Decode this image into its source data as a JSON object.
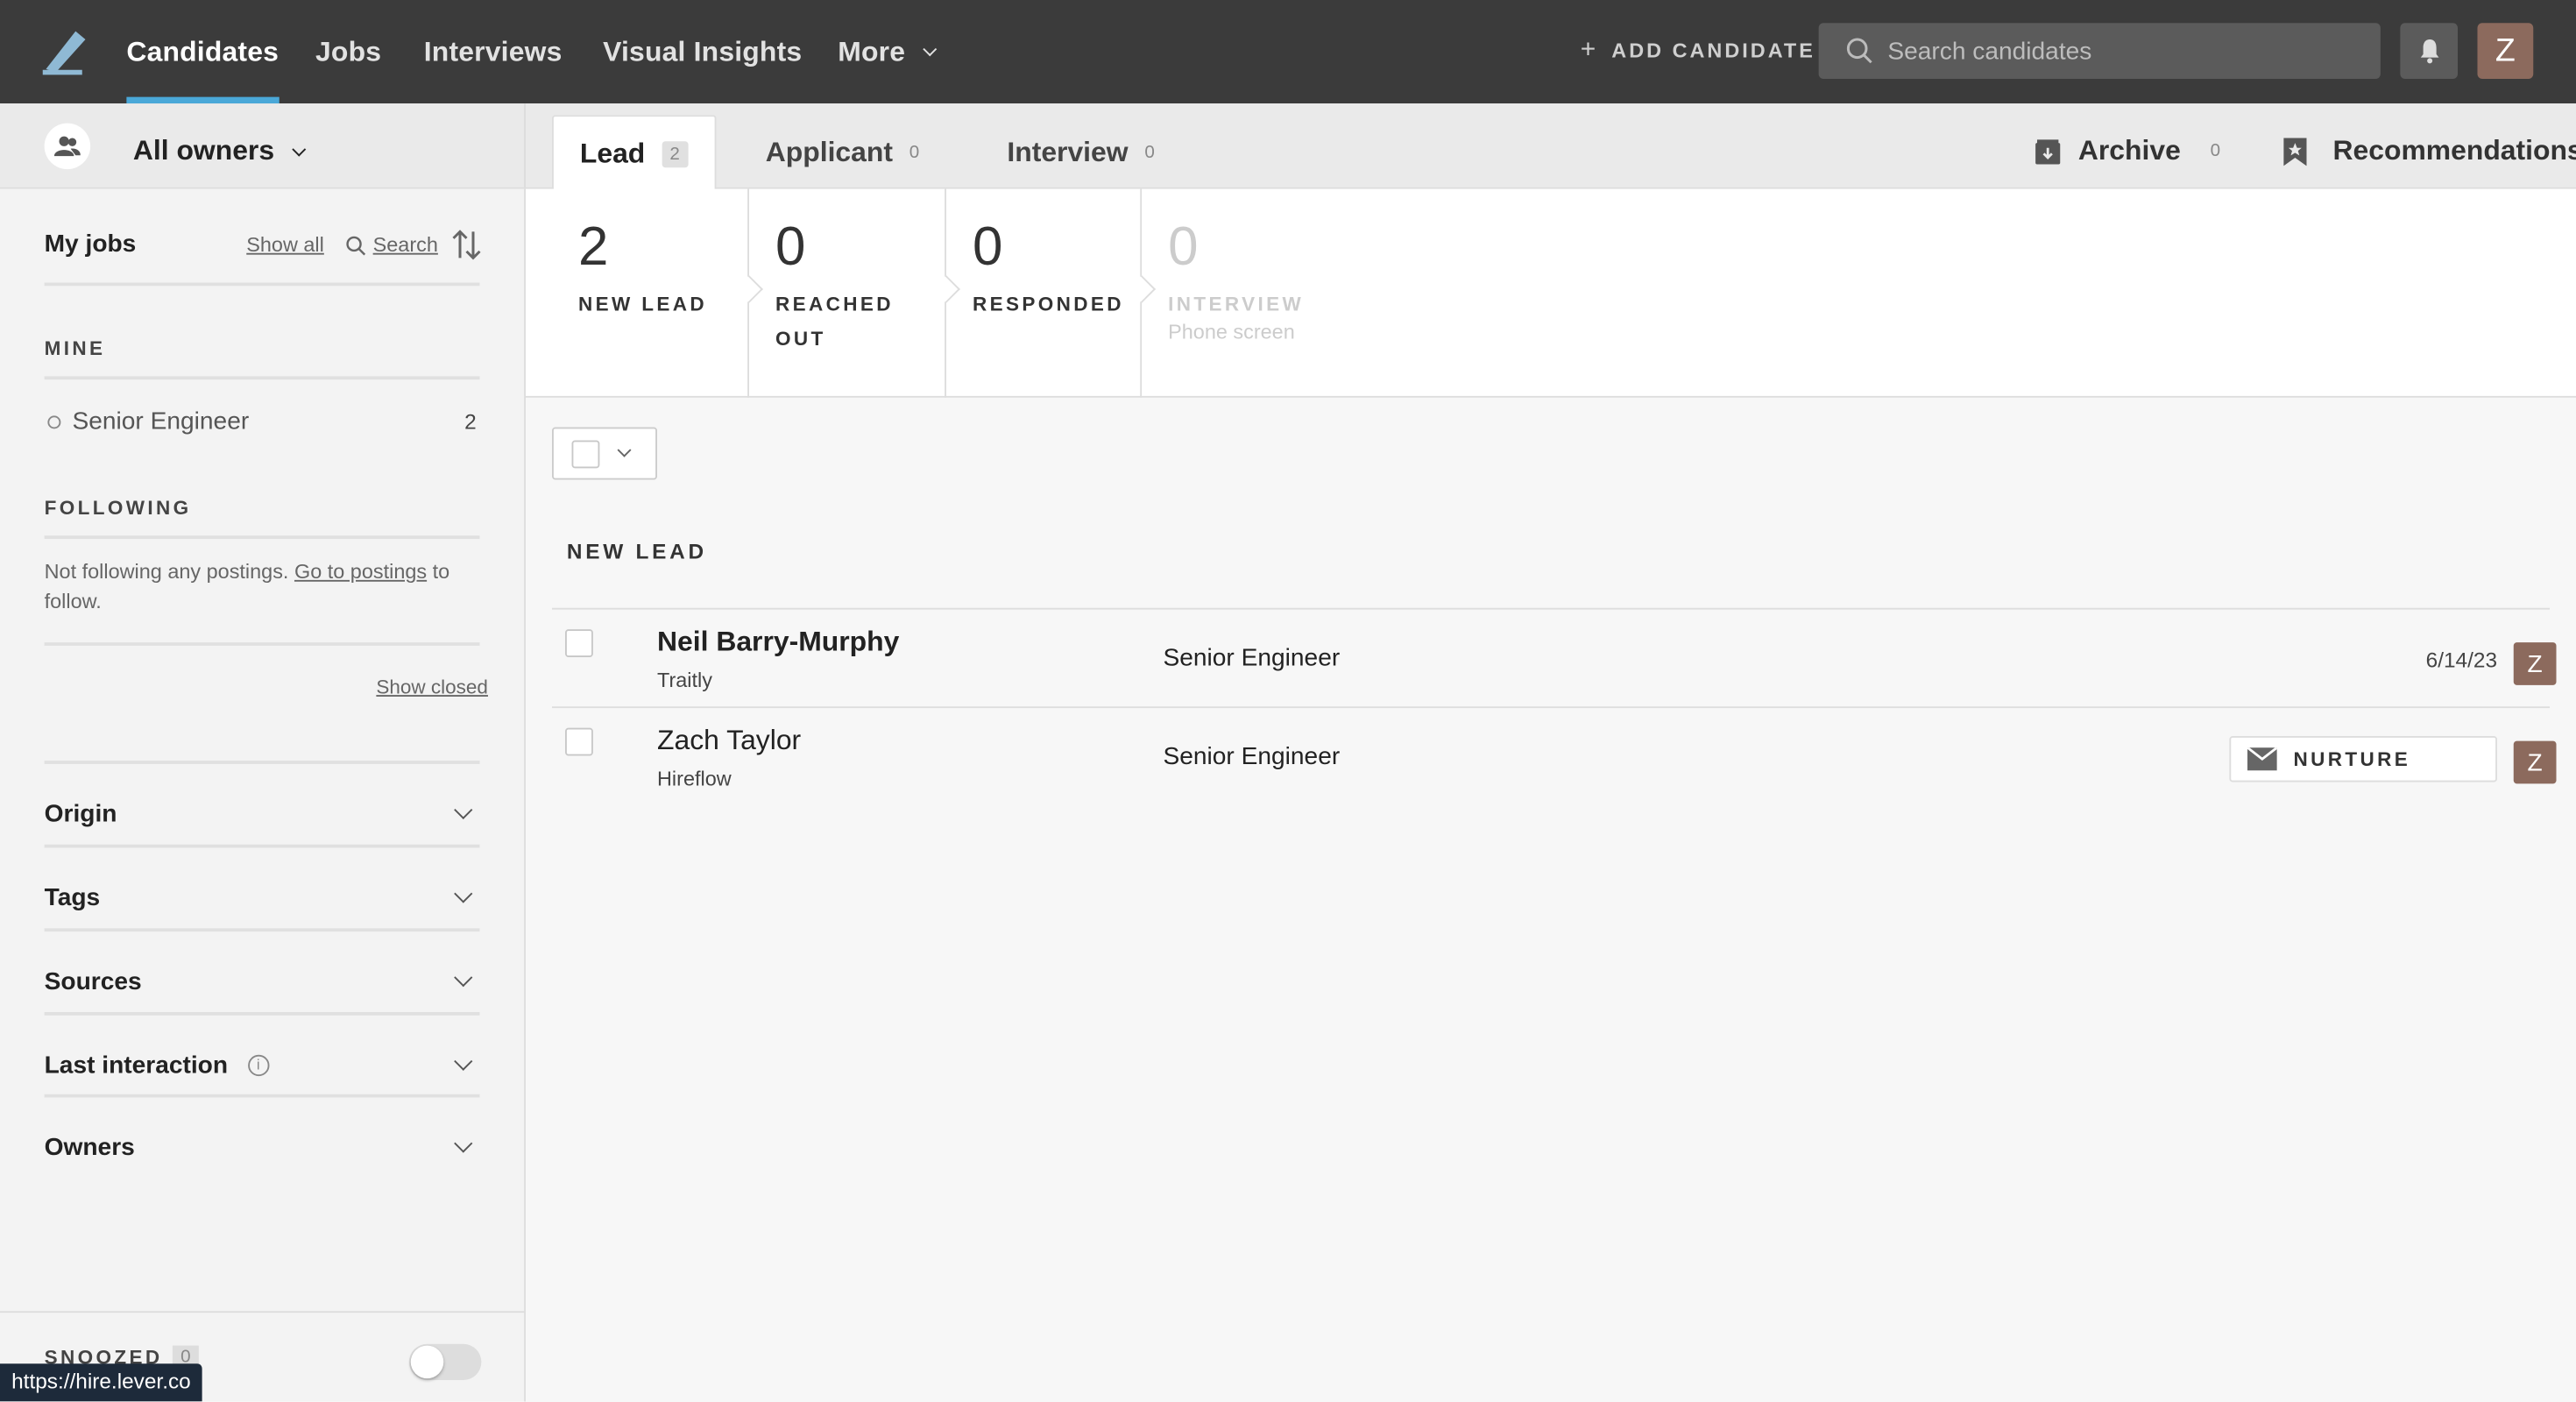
{
  "nav": {
    "items": [
      "Candidates",
      "Jobs",
      "Interviews",
      "Visual Insights",
      "More"
    ],
    "active": "Candidates",
    "add_candidate": "ADD CANDIDATE",
    "search_placeholder": "Search candidates",
    "user_initial": "Z"
  },
  "sidebar": {
    "owner_filter": "All owners",
    "my_jobs": "My jobs",
    "show_all": "Show all",
    "search": "Search",
    "mine_label": "MINE",
    "mine_items": [
      {
        "label": "Senior Engineer",
        "count": "2"
      }
    ],
    "following_label": "FOLLOWING",
    "following_text": "Not following any postings.",
    "go_to_postings": "Go to postings",
    "following_suffix": "to",
    "following_suffix2": "follow.",
    "show_closed": "Show closed",
    "filters": [
      "Origin",
      "Tags",
      "Sources",
      "Last interaction",
      "Owners"
    ],
    "snoozed_label": "SNOOZED",
    "snoozed_count": "0"
  },
  "tabs": {
    "items": [
      {
        "label": "Lead",
        "count": "2"
      },
      {
        "label": "Applicant",
        "count": "0"
      },
      {
        "label": "Interview",
        "count": "0"
      }
    ],
    "archive": {
      "label": "Archive",
      "count": "0"
    },
    "recommendations": "Recommendations"
  },
  "stages": [
    {
      "num": "2",
      "label": "NEW LEAD"
    },
    {
      "num": "0",
      "label": "REACHED",
      "label2": "OUT"
    },
    {
      "num": "0",
      "label": "RESPONDED"
    },
    {
      "num": "0",
      "label": "INTERVIEW",
      "sub": "Phone screen"
    }
  ],
  "list": {
    "section": "NEW LEAD",
    "rows": [
      {
        "name": "Neil Barry-Murphy",
        "company": "Traitly",
        "job": "Senior Engineer",
        "date": "6/14/23",
        "owner": "Z"
      },
      {
        "name": "Zach Taylor",
        "company": "Hireflow",
        "job": "Senior Engineer",
        "tag": "NURTURE",
        "owner": "Z"
      }
    ]
  },
  "statusbar": "https://hire.lever.co",
  "colors": {
    "topbar": "#3b3b3b",
    "accent": "#4aa8d8",
    "avatar": "#8c6a5d"
  }
}
